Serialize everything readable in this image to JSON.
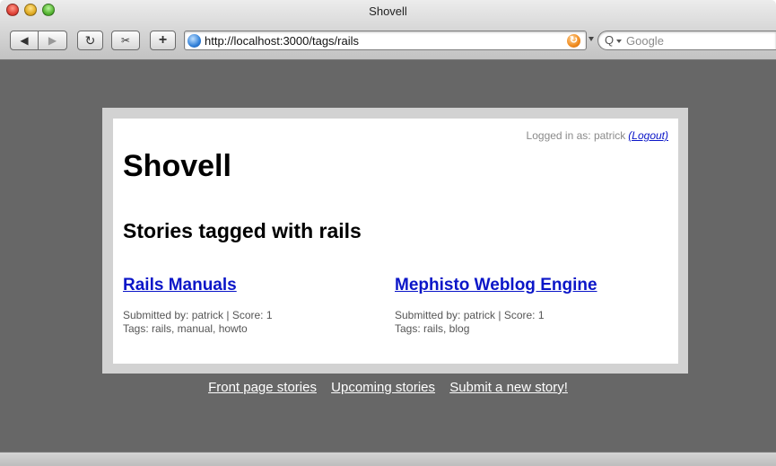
{
  "window": {
    "title": "Shovell"
  },
  "toolbar": {
    "back_glyph": "◀",
    "forward_glyph": "▶",
    "reload_glyph": "↻",
    "snip_glyph": "✂",
    "add_glyph": "+",
    "url": "http://localhost:3000/tags/rails",
    "search_placeholder": "Google"
  },
  "page": {
    "login_text": "Logged in as: patrick",
    "logout_label": "(Logout)",
    "site_title": "Shovell",
    "heading": "Stories tagged with rails",
    "stories": [
      {
        "title": "Rails Manuals",
        "submitted": "Submitted by: patrick | Score: 1",
        "tags": "Tags: rails, manual, howto"
      },
      {
        "title": "Mephisto Weblog Engine",
        "submitted": "Submitted by: patrick | Score: 1",
        "tags": "Tags: rails, blog"
      }
    ],
    "footer_links": [
      "Front page stories",
      "Upcoming stories",
      "Submit a new story!"
    ]
  },
  "colors": {
    "link": "#0b16c8",
    "background": "#676767",
    "frame": "#d2d2d2"
  }
}
